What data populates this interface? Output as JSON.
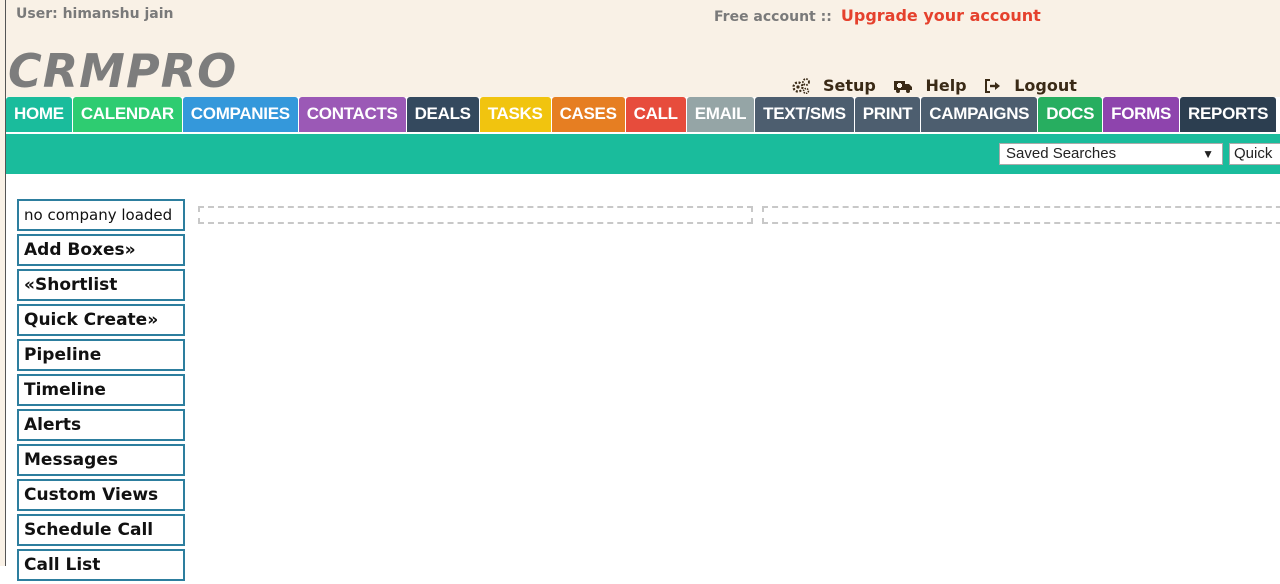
{
  "header": {
    "user_label": "User: himanshu jain",
    "free_account": "Free account ::",
    "upgrade_link": "Upgrade your account",
    "logo": "CRMPRO",
    "links": [
      {
        "label": "Setup",
        "icon": "gears-icon"
      },
      {
        "label": "Help",
        "icon": "ambulance-icon"
      },
      {
        "label": "Logout",
        "icon": "sign-out-icon"
      }
    ]
  },
  "nav": {
    "tabs": [
      {
        "label": "HOME",
        "color": "#1abc9c"
      },
      {
        "label": "CALENDAR",
        "color": "#2ecc71"
      },
      {
        "label": "COMPANIES",
        "color": "#3498db"
      },
      {
        "label": "CONTACTS",
        "color": "#9b59b6"
      },
      {
        "label": "DEALS",
        "color": "#34495e"
      },
      {
        "label": "TASKS",
        "color": "#f1c40f"
      },
      {
        "label": "CASES",
        "color": "#e67e22"
      },
      {
        "label": "CALL",
        "color": "#e74c3c"
      },
      {
        "label": "EMAIL",
        "color": "#95a5a6"
      },
      {
        "label": "TEXT/SMS",
        "color": "#4d5e6f"
      },
      {
        "label": "PRINT",
        "color": "#4d5e6f"
      },
      {
        "label": "CAMPAIGNS",
        "color": "#4d5e6f"
      },
      {
        "label": "DOCS",
        "color": "#27ae60"
      },
      {
        "label": "FORMS",
        "color": "#8e44ad"
      },
      {
        "label": "REPORTS",
        "color": "#2c3e50"
      }
    ]
  },
  "toolbar": {
    "saved_searches": "Saved Searches",
    "quick_search_value": "Quick"
  },
  "sidebar": {
    "company_status": "no company loaded",
    "items": [
      "Add Boxes»",
      "«Shortlist",
      "Quick Create»",
      "Pipeline",
      "Timeline",
      "Alerts",
      "Messages",
      "Custom Views",
      "Schedule Call",
      "Call List"
    ]
  }
}
